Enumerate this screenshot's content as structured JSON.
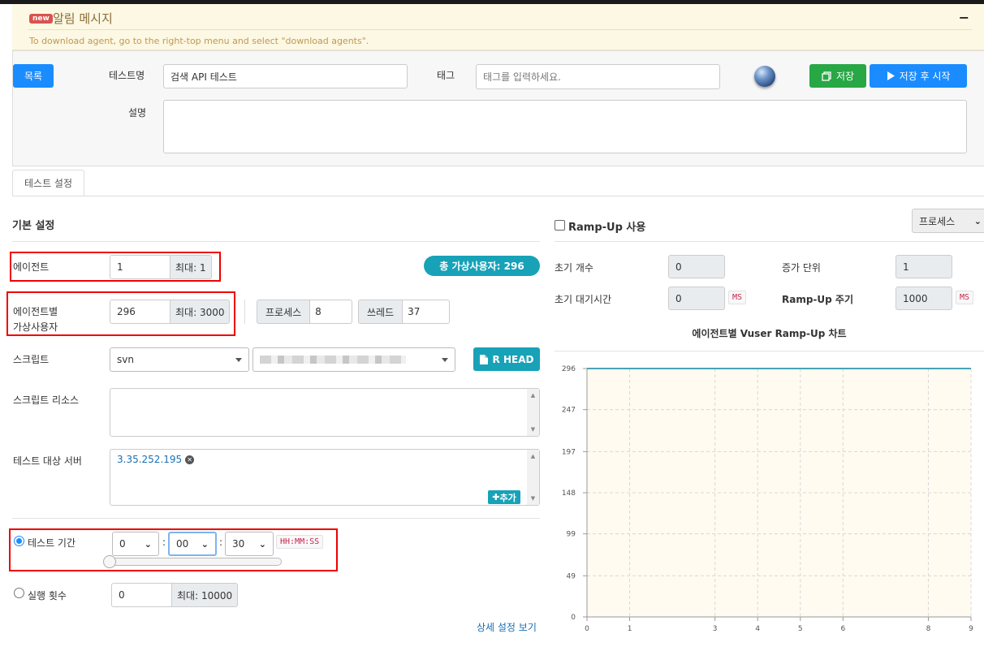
{
  "notice": {
    "badge": "new",
    "title": "알림 메시지",
    "minimize": "−",
    "message": "To download agent, go to the right-top menu and select \"download agents\"."
  },
  "header": {
    "list_button": "목록",
    "test_name_label": "테스트명",
    "test_name_value": "검색 API 테스트",
    "tag_label": "태그",
    "tag_placeholder": "태그를 입력하세요.",
    "description_label": "설명",
    "save_button": "저장",
    "save_start_button": "저장 후 시작"
  },
  "tabs": [
    {
      "label": "테스트 설정"
    }
  ],
  "basic": {
    "section_title": "기본 설정",
    "agent_label": "에이전트",
    "agent_value": "1",
    "agent_max": "최대: 1",
    "total_vusers": "총 가상사용자: 296",
    "vuser_label_1": "에이전트별",
    "vuser_label_2": "가상사용자",
    "vuser_value": "296",
    "vuser_max": "최대: 3000",
    "process_label": "프로세스",
    "process_value": "8",
    "thread_label": "쓰레드",
    "thread_value": "37",
    "script_label": "스크립트",
    "script_repo": "svn",
    "head_button": "R HEAD",
    "resource_label": "스크립트 리소스",
    "target_label": "테스트 대상 서버",
    "target_server": "3.35.252.195",
    "add_button": "추가",
    "duration_label": "테스트 기간",
    "duration_h": "0",
    "duration_m": "00",
    "duration_s": "30",
    "duration_format": "HH:MM:SS",
    "run_count_label": "실행 횟수",
    "run_count_value": "0",
    "run_count_max": "최대: 10000",
    "detail_link": "상세 설정 보기"
  },
  "rampup": {
    "checkbox_label": "Ramp-Up 사용",
    "type_select": "프로세스",
    "initial_count_label": "초기 개수",
    "initial_count_value": "0",
    "step_label": "증가 단위",
    "step_value": "1",
    "initial_sleep_label": "초기 대기시간",
    "initial_sleep_value": "0",
    "ms_unit": "MS",
    "interval_label": "Ramp-Up 주기",
    "interval_value": "1000",
    "interval_unit": "MS"
  },
  "chart_data": {
    "type": "line",
    "title": "에이전트별 Vuser Ramp-Up 차트",
    "xlabel": "",
    "ylabel": "",
    "x_ticks": [
      0,
      1,
      3,
      4,
      5,
      6,
      8,
      9
    ],
    "y_ticks": [
      0,
      49,
      99,
      148,
      197,
      247,
      296
    ],
    "xlim": [
      0,
      9
    ],
    "ylim": [
      0,
      296
    ],
    "grid": true,
    "background": "#fffbf0",
    "series": [
      {
        "color": "#4aa3b5",
        "x": [
          0,
          9
        ],
        "y": [
          296,
          296
        ]
      }
    ]
  }
}
